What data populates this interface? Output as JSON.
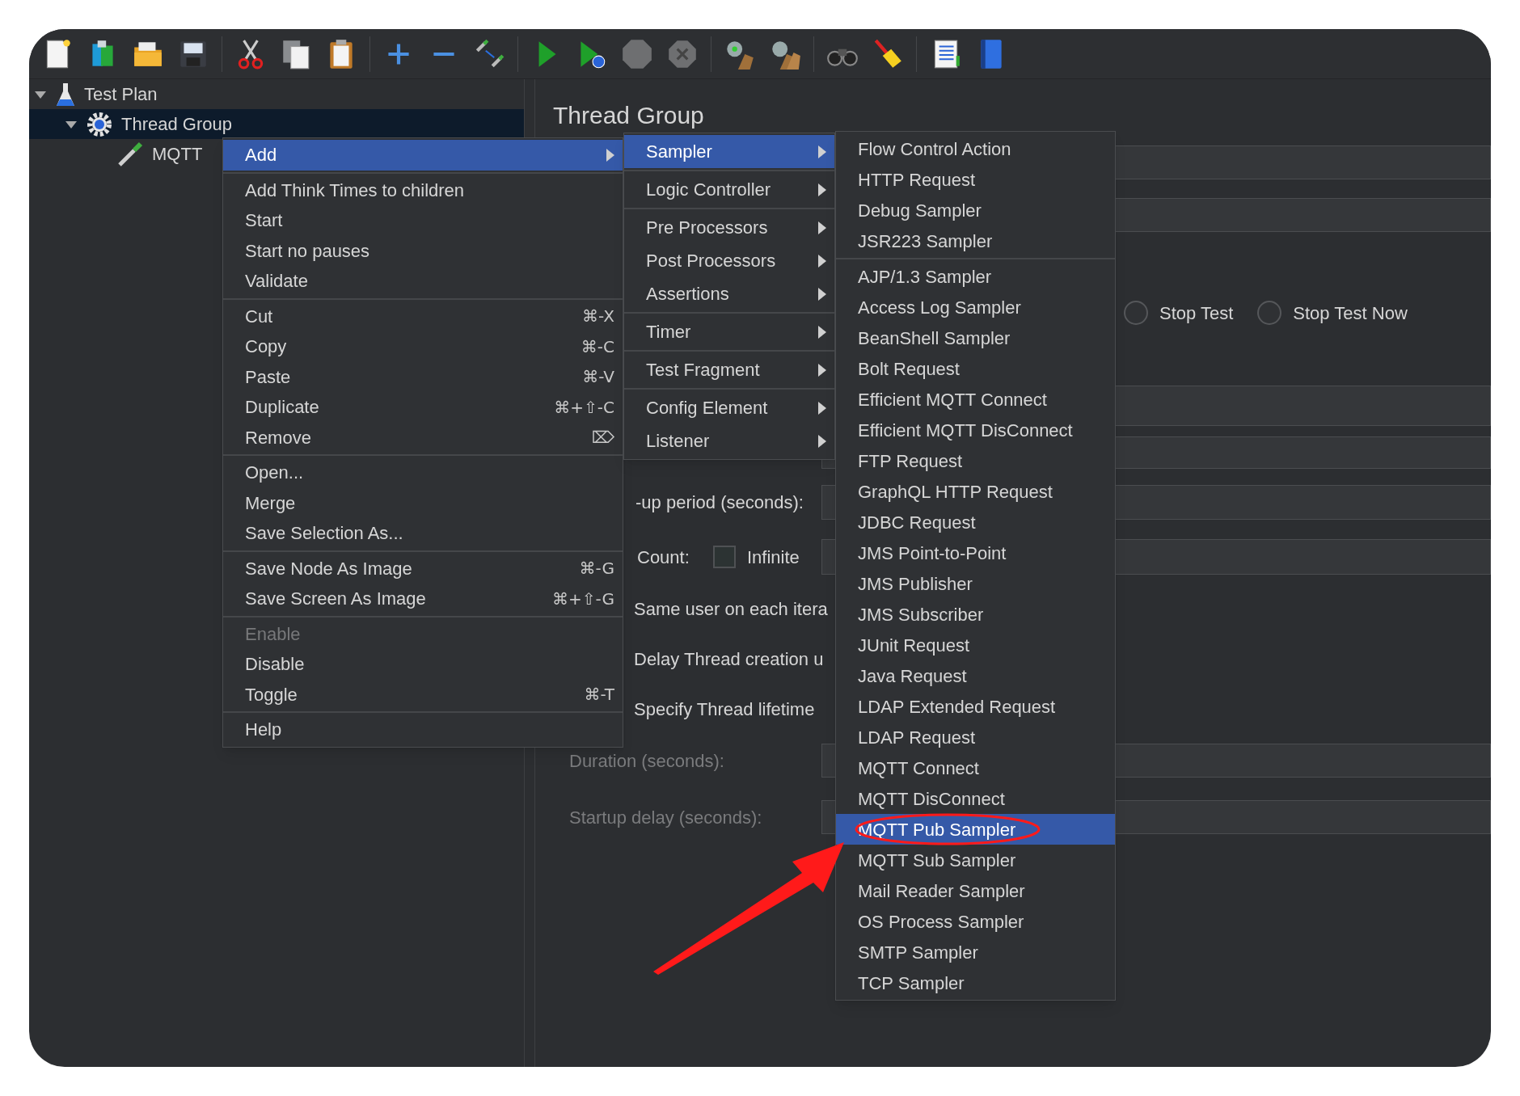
{
  "toolbar": [
    {
      "kind": "new",
      "disabled": false
    },
    {
      "kind": "templates",
      "disabled": false
    },
    {
      "kind": "open",
      "disabled": false
    },
    {
      "kind": "save",
      "disabled": false
    },
    {
      "kind": "separator"
    },
    {
      "kind": "cut",
      "disabled": false
    },
    {
      "kind": "copy",
      "disabled": false
    },
    {
      "kind": "paste",
      "disabled": false
    },
    {
      "kind": "separator"
    },
    {
      "kind": "expand",
      "disabled": false
    },
    {
      "kind": "collapse",
      "disabled": false
    },
    {
      "kind": "toggle",
      "disabled": false
    },
    {
      "kind": "separator"
    },
    {
      "kind": "start",
      "disabled": false
    },
    {
      "kind": "start_no_pauses",
      "disabled": false
    },
    {
      "kind": "stop",
      "disabled": true
    },
    {
      "kind": "shutdown",
      "disabled": true
    },
    {
      "kind": "separator"
    },
    {
      "kind": "clear",
      "disabled": false
    },
    {
      "kind": "clear_all",
      "disabled": false
    },
    {
      "kind": "separator"
    },
    {
      "kind": "search",
      "disabled": false
    },
    {
      "kind": "reset_search",
      "disabled": false
    },
    {
      "kind": "separator"
    },
    {
      "kind": "function_helper",
      "disabled": false
    },
    {
      "kind": "help",
      "disabled": false
    }
  ],
  "tree": [
    {
      "kind": "test_plan",
      "label": "Test Plan",
      "expanded": true,
      "selected": false,
      "children": [
        {
          "kind": "thread_group",
          "label": "Thread Group",
          "expanded": true,
          "selected": true,
          "children": [
            {
              "kind": "sampler",
              "label": "MQTT",
              "selected": false
            }
          ]
        }
      ]
    }
  ],
  "form": {
    "title": "Thread Group",
    "rows": [
      {
        "kind": "field"
      },
      {
        "kind": "field"
      },
      {
        "kind": "radios",
        "options": [
          {
            "label": "Stop Test",
            "selected": false
          },
          {
            "label": "Stop Test Now",
            "selected": false
          }
        ]
      },
      {
        "kind": "field"
      },
      {
        "kind": "field"
      },
      {
        "kind": "labeled_field",
        "label": "-up period (seconds):"
      },
      {
        "kind": "loop",
        "label": "Count:",
        "checkbox": {
          "label": "Infinite",
          "checked": false
        }
      },
      {
        "kind": "text",
        "label": "Same user on each itera"
      },
      {
        "kind": "text",
        "label": "Delay Thread creation u"
      },
      {
        "kind": "text",
        "label": "Specify Thread lifetime"
      },
      {
        "kind": "setting_field",
        "label": "Duration (seconds):",
        "disabled": true
      },
      {
        "kind": "setting_field",
        "label": "Startup delay (seconds):",
        "disabled": true
      }
    ]
  },
  "context_menu": {
    "groups": [
      [
        {
          "label": "Add",
          "submenu": true,
          "selected": true
        }
      ],
      [
        {
          "label": "Add Think Times to children",
          "selected": false,
          "disabled": false
        },
        {
          "label": "Start",
          "selected": false,
          "disabled": false
        },
        {
          "label": "Start no pauses",
          "selected": false,
          "disabled": false
        },
        {
          "label": "Validate",
          "selected": false,
          "disabled": false
        }
      ],
      [
        {
          "label": "Cut",
          "shortcut": "⌘-X",
          "selected": false,
          "disabled": false
        },
        {
          "label": "Copy",
          "shortcut": "⌘-C",
          "selected": false,
          "disabled": false
        },
        {
          "label": "Paste",
          "shortcut": "⌘-V",
          "selected": false,
          "disabled": false
        },
        {
          "label": "Duplicate",
          "shortcut": "⌘+⇧-C",
          "selected": false,
          "disabled": false
        },
        {
          "label": "Remove",
          "shortcut": "⌦",
          "selected": false,
          "disabled": false
        }
      ],
      [
        {
          "label": "Open...",
          "selected": false,
          "disabled": false
        },
        {
          "label": "Merge",
          "selected": false,
          "disabled": false
        },
        {
          "label": "Save Selection As...",
          "selected": false,
          "disabled": false
        }
      ],
      [
        {
          "label": "Save Node As Image",
          "shortcut": "⌘-G",
          "selected": false,
          "disabled": false
        },
        {
          "label": "Save Screen As Image",
          "shortcut": "⌘+⇧-G",
          "selected": false,
          "disabled": false
        }
      ],
      [
        {
          "label": "Enable",
          "selected": false,
          "disabled": true
        },
        {
          "label": "Disable",
          "selected": false,
          "disabled": false
        },
        {
          "label": "Toggle",
          "shortcut": "⌘-T",
          "selected": false,
          "disabled": false
        }
      ],
      [
        {
          "label": "Help",
          "selected": false,
          "disabled": false
        }
      ]
    ]
  },
  "add_menu": {
    "groups": [
      [
        {
          "label": "Sampler",
          "submenu": true,
          "selected": true
        }
      ],
      [
        {
          "label": "Logic Controller",
          "submenu": true,
          "selected": false
        }
      ],
      [
        {
          "label": "Pre Processors",
          "submenu": true,
          "selected": false
        },
        {
          "label": "Post Processors",
          "submenu": true,
          "selected": false
        },
        {
          "label": "Assertions",
          "submenu": true,
          "selected": false
        }
      ],
      [
        {
          "label": "Timer",
          "submenu": true,
          "selected": false
        }
      ],
      [
        {
          "label": "Test Fragment",
          "submenu": true,
          "selected": false
        }
      ],
      [
        {
          "label": "Config Element",
          "submenu": true,
          "selected": false
        },
        {
          "label": "Listener",
          "submenu": true,
          "selected": false
        }
      ]
    ]
  },
  "sampler_menu": {
    "groups": [
      [
        {
          "label": "Flow Control Action",
          "selected": false
        },
        {
          "label": "HTTP Request",
          "selected": false
        },
        {
          "label": "Debug Sampler",
          "selected": false
        },
        {
          "label": "JSR223 Sampler",
          "selected": false
        }
      ],
      [
        {
          "label": "AJP/1.3 Sampler",
          "selected": false
        },
        {
          "label": "Access Log Sampler",
          "selected": false
        },
        {
          "label": "BeanShell Sampler",
          "selected": false
        },
        {
          "label": "Bolt Request",
          "selected": false
        },
        {
          "label": "Efficient MQTT Connect",
          "selected": false
        },
        {
          "label": "Efficient MQTT DisConnect",
          "selected": false
        },
        {
          "label": "FTP Request",
          "selected": false
        },
        {
          "label": "GraphQL HTTP Request",
          "selected": false
        },
        {
          "label": "JDBC Request",
          "selected": false
        },
        {
          "label": "JMS Point-to-Point",
          "selected": false
        },
        {
          "label": "JMS Publisher",
          "selected": false
        },
        {
          "label": "JMS Subscriber",
          "selected": false
        },
        {
          "label": "JUnit Request",
          "selected": false
        },
        {
          "label": "Java Request",
          "selected": false
        },
        {
          "label": "LDAP Extended Request",
          "selected": false
        },
        {
          "label": "LDAP Request",
          "selected": false
        },
        {
          "label": "MQTT Connect",
          "selected": false
        },
        {
          "label": "MQTT DisConnect",
          "selected": false
        },
        {
          "label": "MQTT Pub Sampler",
          "selected": true
        },
        {
          "label": "MQTT Sub Sampler",
          "selected": false
        },
        {
          "label": "Mail Reader Sampler",
          "selected": false
        },
        {
          "label": "OS Process Sampler",
          "selected": false
        },
        {
          "label": "SMTP Sampler",
          "selected": false
        },
        {
          "label": "TCP Sampler",
          "selected": false
        }
      ]
    ]
  },
  "annotation": {
    "kind": "arrow_and_circle",
    "color": "#ff1a1a"
  }
}
